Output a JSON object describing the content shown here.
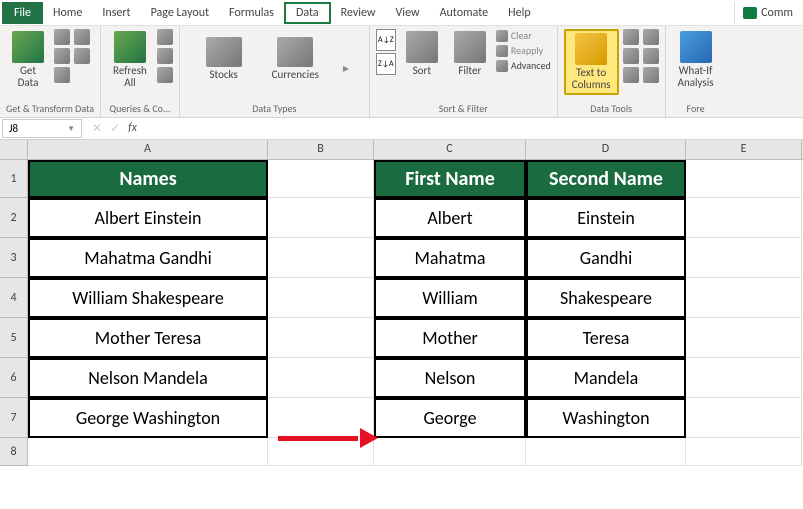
{
  "menubar": {
    "items": [
      "File",
      "Home",
      "Insert",
      "Page Layout",
      "Formulas",
      "Data",
      "Review",
      "View",
      "Automate",
      "Help"
    ],
    "active": "Data",
    "comments_label": "Comm"
  },
  "ribbon": {
    "groups": [
      {
        "label": "Get & Transform Data",
        "getdata": "Get\nData"
      },
      {
        "label": "Queries & Co...",
        "refresh": "Refresh\nAll"
      },
      {
        "label": "Data Types",
        "stocks": "Stocks",
        "currencies": "Currencies"
      },
      {
        "label": "Sort & Filter",
        "sort": "Sort",
        "filter": "Filter",
        "clear": "Clear",
        "reapply": "Reapply",
        "advanced": "Advanced"
      },
      {
        "label": "Data Tools",
        "text_to_columns": "Text to\nColumns"
      },
      {
        "label": "Fore",
        "whatif": "What-If\nAnalysis"
      }
    ]
  },
  "formula_bar": {
    "name_box": "J8",
    "fx": "fx"
  },
  "columns": [
    "A",
    "B",
    "C",
    "D",
    "E"
  ],
  "rows": [
    "1",
    "2",
    "3",
    "4",
    "5",
    "6",
    "7",
    "8"
  ],
  "table1": {
    "header": "Names",
    "data": [
      "Albert Einstein",
      "Mahatma Gandhi",
      "William Shakespeare",
      "Mother Teresa",
      "Nelson Mandela",
      "George Washington"
    ]
  },
  "table2": {
    "headers": [
      "First Name",
      "Second Name"
    ],
    "data": [
      [
        "Albert",
        "Einstein"
      ],
      [
        "Mahatma",
        "Gandhi"
      ],
      [
        "William",
        "Shakespeare"
      ],
      [
        "Mother",
        "Teresa"
      ],
      [
        "Nelson",
        "Mandela"
      ],
      [
        "George",
        "Washington"
      ]
    ]
  }
}
